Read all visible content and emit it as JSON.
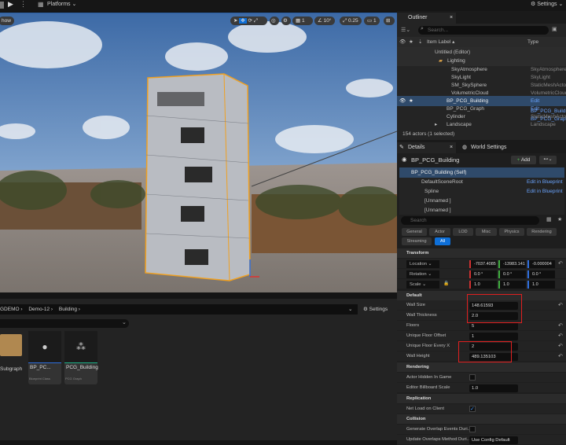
{
  "toolbar": {
    "platforms": "Platforms",
    "settings": "Settings"
  },
  "viewport": {
    "show": "how",
    "grid_snap": "1",
    "angle_snap": "10°",
    "scale_snap": "0.25",
    "camera_speed": "1"
  },
  "content_browser": {
    "breadcrumb": [
      "GDEMO",
      "Demo-12",
      "Building"
    ],
    "settings": "Settings",
    "assets": [
      {
        "name": "Subgraph",
        "type": ""
      },
      {
        "name": "BP_PC...",
        "type": "Blueprint Class",
        "color": "#2f6fe0"
      },
      {
        "name": "PCG_Building",
        "type": "PCG Graph",
        "color": "#1fb38a"
      }
    ]
  },
  "outliner": {
    "tab": "Outliner",
    "search_placeholder": "Search...",
    "col_label": "Item Label ▴",
    "col_type": "Type",
    "items": [
      {
        "label": "Untitled (Editor)",
        "type": ""
      },
      {
        "label": "Lighting",
        "type": ""
      },
      {
        "label": "SkyAtmosphere",
        "type": "SkyAtmosphere"
      },
      {
        "label": "SkyLight",
        "type": "SkyLight"
      },
      {
        "label": "SM_SkySphere",
        "type": "StaticMeshActor"
      },
      {
        "label": "VolumetricCloud",
        "type": "VolumetricCloud"
      },
      {
        "label": "BP_PCG_Building",
        "type": "Edit BP_PCG_Building"
      },
      {
        "label": "BP_PCG_Graph",
        "type": "Edit BP_PCG_Graph"
      },
      {
        "label": "Cylinder",
        "type": "StaticMeshActor"
      },
      {
        "label": "Landscape",
        "type": "Landscape"
      }
    ],
    "status": "154 actors (1 selected)"
  },
  "details": {
    "tab": "Details",
    "world_tab": "World Settings",
    "actor": "BP_PCG_Building",
    "add": "Add",
    "components": [
      {
        "label": "BP_PCG_Building (Self)",
        "link": ""
      },
      {
        "label": "DefaultSceneRoot",
        "link": "Edit in Blueprint"
      },
      {
        "label": "Spline",
        "link": "Edit in Blueprint"
      },
      {
        "label": "[Unnamed ]",
        "link": ""
      },
      {
        "label": "[Unnamed ]",
        "link": ""
      }
    ],
    "search_placeholder": "Search",
    "filters": [
      "General",
      "Actor",
      "LOD",
      "Misc",
      "Physics",
      "Rendering",
      "Streaming",
      "All"
    ],
    "transform": {
      "title": "Transform",
      "location_label": "Location",
      "rotation_label": "Rotation",
      "scale_label": "Scale",
      "location": [
        "-7037.4085",
        "-13983.141",
        "-0.000004"
      ],
      "rotation": [
        "0.0 °",
        "0.0 °",
        "0.0 °"
      ],
      "scale": [
        "1.0",
        "1.0",
        "1.0"
      ]
    },
    "default": {
      "title": "Default",
      "wall_size_label": "Wall Size",
      "wall_size": "148.61593",
      "wall_thickness_label": "Wall Thickness",
      "wall_thickness": "2.0",
      "floors_label": "Floors",
      "floors": "5",
      "unique_floor_offset_label": "Unique Floor Offset",
      "unique_floor_offset": "1",
      "unique_floor_every_label": "Unique Floor Every X",
      "unique_floor_every": "2",
      "wall_height_label": "Wall Height",
      "wall_height": "489.135103"
    },
    "rendering": {
      "title": "Rendering",
      "hidden_label": "Actor Hidden In Game",
      "billboard_label": "Editor Billboard Scale",
      "billboard": "1.0"
    },
    "replication": {
      "title": "Replication",
      "net_load_label": "Net Load on Client"
    },
    "collision": {
      "title": "Collision",
      "overlap_label": "Generate Overlap Events Duri...",
      "update_label": "Update Overlaps Method Duri...",
      "update_value": "Use Config Default"
    }
  },
  "colors": {
    "accent": "#0e6fd8",
    "selected_row": "#2f4a6a",
    "highlight": "#e02020"
  }
}
